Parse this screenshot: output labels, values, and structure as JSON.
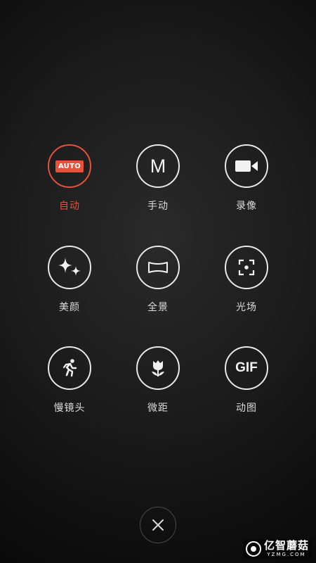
{
  "modes": [
    {
      "key": "auto",
      "label": "自动",
      "icon": "auto-badge-icon",
      "badge_text": "AUTO",
      "active": true
    },
    {
      "key": "manual",
      "label": "手动",
      "icon": "m-letter-icon",
      "glyph": "M",
      "active": false
    },
    {
      "key": "video",
      "label": "录像",
      "icon": "video-camera-icon",
      "active": false
    },
    {
      "key": "beauty",
      "label": "美颜",
      "icon": "sparkles-icon",
      "active": false
    },
    {
      "key": "panorama",
      "label": "全景",
      "icon": "panorama-icon",
      "active": false
    },
    {
      "key": "light-field",
      "label": "光场",
      "icon": "focus-frame-icon",
      "active": false
    },
    {
      "key": "slow-motion",
      "label": "慢镜头",
      "icon": "running-person-icon",
      "active": false
    },
    {
      "key": "macro",
      "label": "微距",
      "icon": "tulip-icon",
      "active": false
    },
    {
      "key": "gif",
      "label": "动图",
      "icon": "gif-text-icon",
      "glyph": "GIF",
      "active": false
    }
  ],
  "close_icon": "close-icon",
  "watermark": {
    "title": "亿智蘑菇",
    "subtitle": "YZMG.COM"
  },
  "colors": {
    "accent": "#e6523a",
    "icon": "#f0f0f0",
    "label": "#dcdcdc",
    "background": "#1a1a1a"
  }
}
